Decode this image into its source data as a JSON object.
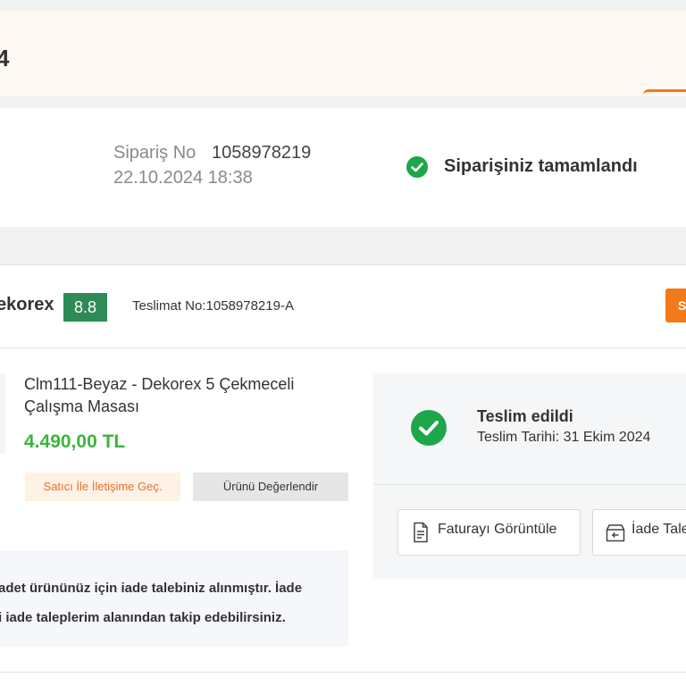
{
  "banner": {
    "title": "4"
  },
  "order": {
    "number_label": "Sipariş No",
    "number_value": "1058978219",
    "date": "22.10.2024 18:38",
    "status": "Siparişiniz tamamlandı"
  },
  "shipment": {
    "seller": "ekorex",
    "score": "8.8",
    "delivery_label": "Teslimat No:",
    "delivery_no": "1058978219-A",
    "action_label": "S"
  },
  "product": {
    "name_line1": "Clm111-Beyaz - Dekorex 5 Çekmeceli",
    "name_line2": "Çalışma Masası",
    "price": "4.490,00 TL",
    "contact_seller": "Satıcı İle İletişime Geç.",
    "review": "Ürünü Değerlendir"
  },
  "return_note": {
    "line1": "adet ürününüz için iade talebiniz alınmıştır. İade",
    "line2": "i iade taleplerim alanından takip edebilirsiniz."
  },
  "delivery": {
    "title": "Teslim edildi",
    "date": "Teslim Tarihi: 31 Ekim 2024",
    "invoice_button": "Faturayı Görüntüle",
    "return_button": "İade Tale"
  },
  "colors": {
    "accent": "#f27a1a",
    "success": "#1ea64a",
    "score": "#2e8b57",
    "price": "#3cb43c"
  }
}
